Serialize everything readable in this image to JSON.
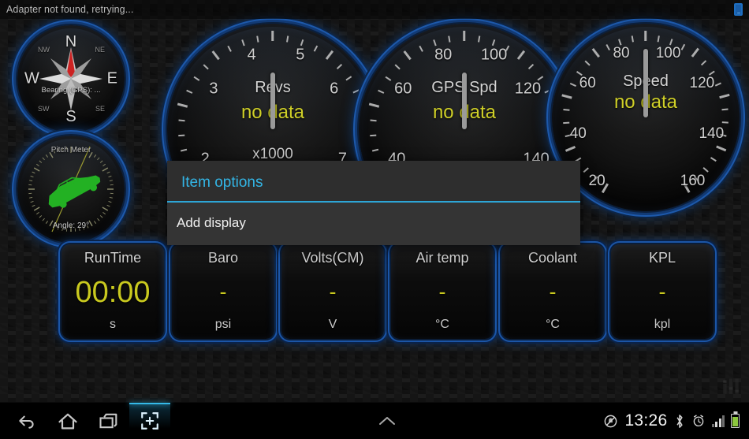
{
  "statusbar": {
    "message": "Adapter not found, retrying...",
    "right_icon": "tablet-icon"
  },
  "compass": {
    "name": "compass-widget",
    "cardinals": [
      "N",
      "E",
      "S",
      "W"
    ],
    "intercardinals": [
      "NW",
      "NE",
      "SE",
      "SW"
    ],
    "bearing_text": "Bearing (GPS): ..."
  },
  "pitch_meter": {
    "title": "Pitch Meter",
    "angle_text": "Angle: 29°",
    "car_color": "#23b123"
  },
  "gauges": [
    {
      "id": "revs",
      "title": "Revs",
      "value": "no data",
      "sub": "x1000",
      "ticks": [
        "2",
        "3",
        "4",
        "5",
        "6",
        "7"
      ],
      "value_color": "#cfcf28"
    },
    {
      "id": "gps-speed",
      "title": "GPS Spd",
      "value": "no data",
      "sub": "",
      "ticks": [
        "40",
        "60",
        "80",
        "100",
        "120",
        "140"
      ],
      "value_color": "#cfcf28"
    },
    {
      "id": "speed",
      "title": "Speed",
      "value": "no data",
      "sub": "",
      "ticks": [
        "20",
        "40",
        "60",
        "80",
        "100",
        "120",
        "140",
        "160"
      ],
      "value_color": "#cfcf28"
    }
  ],
  "tiles": [
    {
      "label": "RunTime",
      "value": "00:00",
      "unit": "s"
    },
    {
      "label": "Baro",
      "value": "-",
      "unit": "psi"
    },
    {
      "label": "Volts(CM)",
      "value": "-",
      "unit": "V"
    },
    {
      "label": "Air temp",
      "value": "-",
      "unit": "°C"
    },
    {
      "label": "Coolant",
      "value": "-",
      "unit": "°C"
    },
    {
      "label": "KPL",
      "value": "-",
      "unit": "kpl"
    }
  ],
  "dialog": {
    "title": "Item options",
    "items": [
      "Add display"
    ],
    "title_color": "#33b5e5",
    "divider_color": "#2da5d6"
  },
  "navbar": {
    "buttons": [
      "back-icon",
      "home-icon",
      "recents-icon",
      "screenshot-icon"
    ],
    "center_icon": "chevron-up-icon",
    "clock": "13:26",
    "status_icons": [
      "silent-mode-icon",
      "bluetooth-icon",
      "alarm-icon",
      "signal-icon",
      "battery-icon"
    ]
  },
  "accent": {
    "gauge_ring": "#1b55a6",
    "value_yellow": "#c9c91f",
    "cyan": "#33b5e5"
  }
}
